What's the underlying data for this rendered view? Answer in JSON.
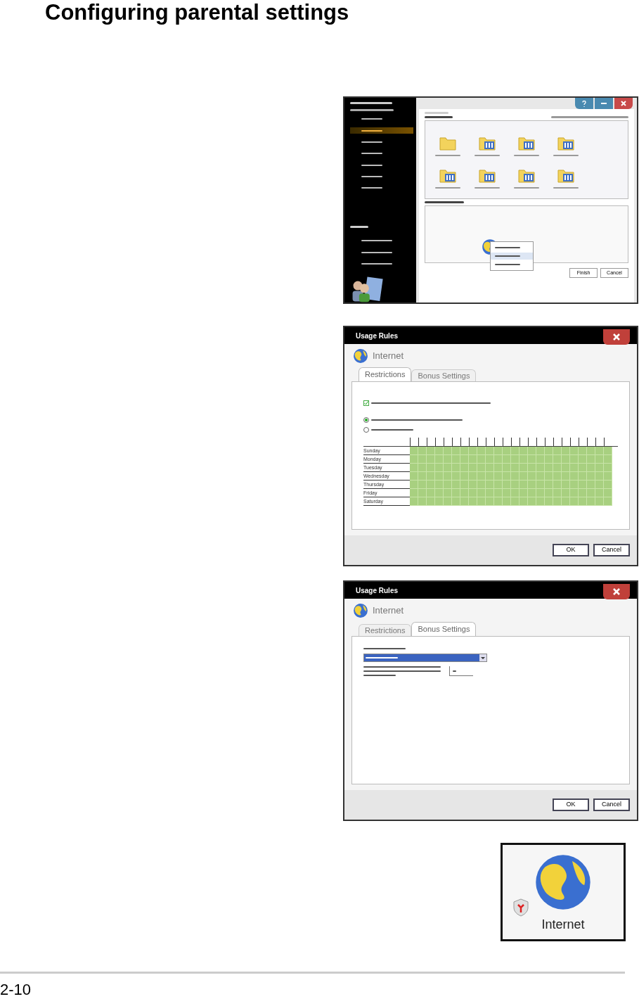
{
  "page": {
    "heading": "Configuring parental settings",
    "page_number": "2-10"
  },
  "account_window": {
    "sidebar_items": [
      {
        "selected": false
      },
      {
        "selected": true
      },
      {
        "selected": false
      },
      {
        "selected": false
      },
      {
        "selected": false
      },
      {
        "selected": false
      },
      {
        "selected": false
      }
    ],
    "link_items": [
      {
        "selected": false
      },
      {
        "selected": false
      },
      {
        "selected": false
      }
    ],
    "program_rows": [
      {
        "kind": "folder"
      },
      {
        "kind": "tools"
      },
      {
        "kind": "tools"
      },
      {
        "kind": "tools"
      },
      {
        "kind": "tools"
      },
      {
        "kind": "tools"
      },
      {
        "kind": "tools"
      },
      {
        "kind": "tools"
      }
    ],
    "context_menu": [
      {
        "selected": false
      },
      {
        "selected": true
      },
      {
        "selected": false
      }
    ],
    "buttons": [
      "Finish",
      "Cancel"
    ]
  },
  "restrictions_window": {
    "title": "Usage Rules",
    "program": "Internet",
    "tabs": [
      {
        "label": "Restrictions",
        "selected": true
      },
      {
        "label": "Bonus Settings",
        "selected": false
      }
    ],
    "limit_checkbox": {
      "checked": true
    },
    "radios": [
      {
        "selected": true
      },
      {
        "selected": false
      }
    ],
    "days": [
      {
        "day": "Sunday",
        "allowed": true
      },
      {
        "day": "Monday",
        "allowed": true
      },
      {
        "day": "Tuesday",
        "allowed": true
      },
      {
        "day": "Wednesday",
        "allowed": true
      },
      {
        "day": "Thursday",
        "allowed": true
      },
      {
        "day": "Friday",
        "allowed": true
      },
      {
        "day": "Saturday",
        "allowed": true
      }
    ],
    "buttons": [
      "OK",
      "Cancel"
    ]
  },
  "bonus_window": {
    "title": "Usage Rules",
    "program": "Internet",
    "tabs": [
      {
        "label": "Restrictions",
        "selected": false
      },
      {
        "label": "Bonus Settings",
        "selected": true
      }
    ],
    "buttons": [
      "OK",
      "Cancel"
    ]
  },
  "program_icon": {
    "label": "Internet"
  }
}
